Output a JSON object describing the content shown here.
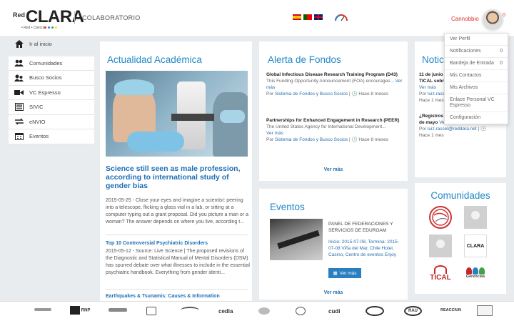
{
  "header": {
    "logo_prefix": "Red",
    "logo_main": "CLARA",
    "logo_sub": "• Red • Ciencia",
    "section": "COLABORATORIO",
    "user_name": "Cannobbio",
    "badge": "0"
  },
  "dropdown": [
    {
      "label": "Ver Perfil",
      "count": ""
    },
    {
      "label": "Notificaciones",
      "count": "0"
    },
    {
      "label": "Bandeja de Entrada",
      "count": "0"
    },
    {
      "label": "Mis Contactos",
      "count": ""
    },
    {
      "label": "Mis Archivos",
      "count": ""
    },
    {
      "label": "Enlace Personal VC Espresso",
      "count": ""
    },
    {
      "label": "Configuración",
      "count": ""
    }
  ],
  "sidebar": [
    {
      "label": "Ir al inicio",
      "icon": "home-icon"
    },
    {
      "label": "Comunidades",
      "icon": "group-icon"
    },
    {
      "label": "Busco Socios",
      "icon": "partners-icon"
    },
    {
      "label": "VC Espresso",
      "icon": "video-icon"
    },
    {
      "label": "SIVIC",
      "icon": "sivic-icon"
    },
    {
      "label": "eNVIO",
      "icon": "transfer-icon"
    },
    {
      "label": "Eventos",
      "icon": "calendar-icon"
    }
  ],
  "actualidad": {
    "title": "Actualidad Académica",
    "headline": "Science still seen as male profession, according to international study of gender bias",
    "text": "2015-05-25 - Close your eyes and imagine a scientist: peering into a telescope, flicking a glass vial in a lab, or sitting at a computer typing out a grant proposal. Did you picture a man or a woman? The answer depends on where you live, according t...",
    "news2_title": "Top 10 Controversial Psychiatric Disorders",
    "news2_text": "2015-05-12 - Source: Live Science | The proposed revisions of the Diagnostic and Statistical Manual of Mental Disorders (DSM) has spurred debate over what illnesses to include in the essential psychiatric handbook. Everything from gender identi...",
    "news3_title": "Earthquakes & Tsunamis: Causes & Information"
  },
  "alerta": {
    "title": "Alerta de Fondos",
    "items": [
      {
        "title": "Global Infectious Disease Research Training Program (D43)",
        "desc": "This Funding Opportunity Announcement (FOA) encourages...",
        "more": "Ver más",
        "by": "Por",
        "source": "Sistema de Fondos y Busco Socios",
        "time": "Hace 8 meses"
      },
      {
        "title": "Partnerships for Enhanced Engagement in Research (PEER)",
        "desc": "The United States Agency for International Development...",
        "more": "Ver más",
        "by": "Por",
        "source": "Sistema de Fondos y Busco Socios",
        "time": "Hace 8 meses"
      }
    ],
    "more": "Ver más"
  },
  "eventos": {
    "title": "Eventos",
    "event_title": "PANEL DE FEDERACIONES Y SERVICIOS DE EDUROAM",
    "event_text": "Inicio: 2015-07-08, Termina: 2015-07-08 Viña del Mar, Chile Hotel, Casino, Centro de eventos Enjoy",
    "button": "Ver más",
    "more": "Ver más"
  },
  "noticias": {
    "title": "Noticias",
    "item1_date": "11 de junio",
    "item1_title": "TICAL sobre Identidad",
    "item1_more": "Ver más",
    "item1_by": "Por",
    "item1_email": "luiz.rassel",
    "item1_time": "Hace 1 mes",
    "item2_title": "¿Registros rebajada? Sólo hasta el 31 de mayo",
    "item2_more": "Ver más",
    "item2_by": "Por",
    "item2_email": "luiz.rassel@reddara.net",
    "item2_time": "Hace 1 mes"
  },
  "comunidades": {
    "title": "Comunidades",
    "logos": [
      "CLARA",
      "TICAL",
      "Gerencias"
    ]
  },
  "footer_sponsors": [
    "RNP",
    "cedia",
    "cudi",
    "RAU",
    "REACCIUN"
  ]
}
